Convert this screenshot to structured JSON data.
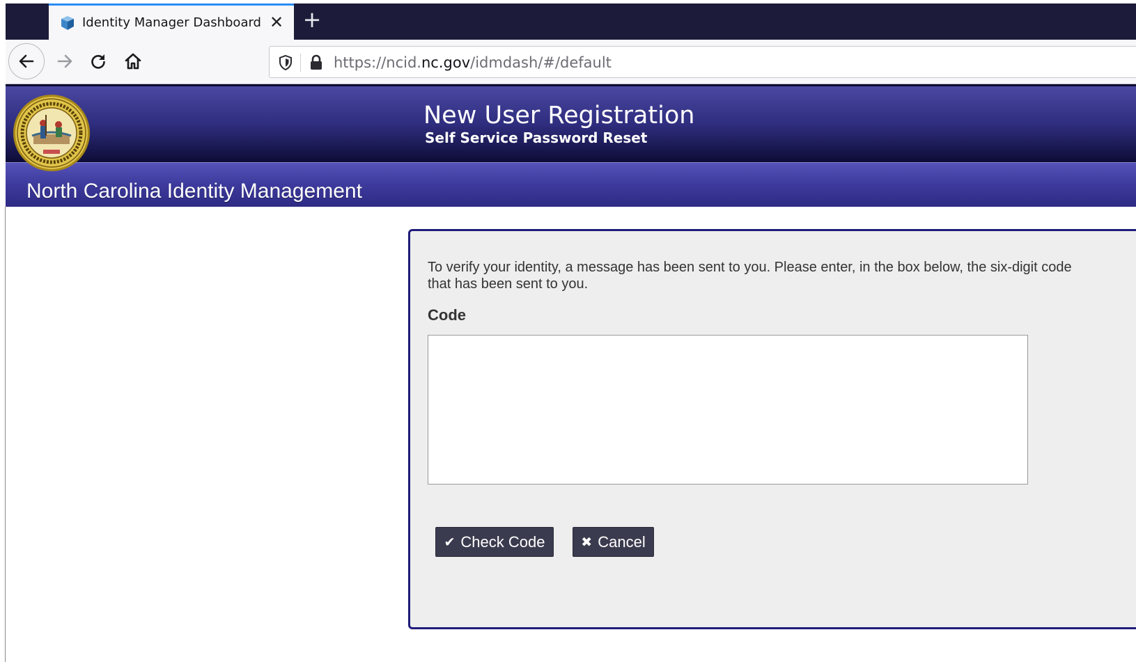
{
  "browser": {
    "tab_title": "Identity Manager Dashboard",
    "tab_icon": "identity-manager-cube-icon",
    "close_glyph": "✕",
    "new_tab_glyph": "+",
    "url": {
      "scheme_and_sub": "https://ncid.",
      "host": "nc.gov",
      "path": "/idmdash/#/default"
    }
  },
  "header": {
    "title": "New User Registration",
    "subtitle": "Self Service Password Reset",
    "seal_icon": "nc-state-seal-icon",
    "subheader_title": "North Carolina Identity Management"
  },
  "panel": {
    "instructions": "To verify your identity, a message has been sent to you. Please enter, in the box below, the six-digit code that has been sent to you.",
    "code_label": "Code",
    "code_value": "",
    "check_button": {
      "icon": "✔",
      "label": "Check Code"
    },
    "cancel_button": {
      "icon": "✖",
      "label": "Cancel"
    }
  },
  "colors": {
    "header_dark": "#0d0c36",
    "header_mid": "#2f2d7e",
    "panel_border": "#1f1d7a",
    "button_bg": "#3b3b4f",
    "tab_accent": "#2a8cf5"
  }
}
